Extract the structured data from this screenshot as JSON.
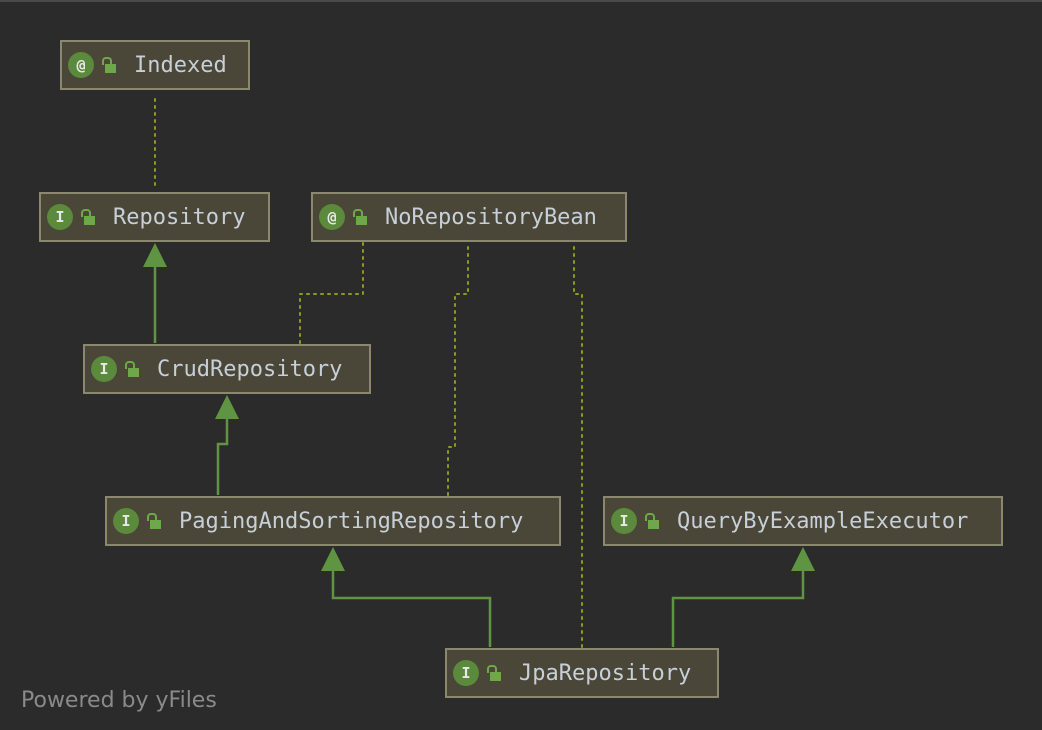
{
  "diagram": {
    "nodes": {
      "indexed": {
        "kind": "@",
        "label": "Indexed"
      },
      "repository": {
        "kind": "I",
        "label": "Repository"
      },
      "no_repository_bean": {
        "kind": "@",
        "label": "NoRepositoryBean"
      },
      "crud_repository": {
        "kind": "I",
        "label": "CrudRepository"
      },
      "paging_and_sorting_repository": {
        "kind": "I",
        "label": "PagingAndSortingRepository"
      },
      "query_by_example_executor": {
        "kind": "I",
        "label": "QueryByExampleExecutor"
      },
      "jpa_repository": {
        "kind": "I",
        "label": "JpaRepository"
      }
    },
    "edges": [
      {
        "from": "repository",
        "to": "indexed",
        "type": "annotation"
      },
      {
        "from": "crud_repository",
        "to": "repository",
        "type": "extends"
      },
      {
        "from": "crud_repository",
        "to": "no_repository_bean",
        "type": "annotation"
      },
      {
        "from": "paging_and_sorting_repository",
        "to": "crud_repository",
        "type": "extends"
      },
      {
        "from": "paging_and_sorting_repository",
        "to": "no_repository_bean",
        "type": "annotation"
      },
      {
        "from": "jpa_repository",
        "to": "paging_and_sorting_repository",
        "type": "extends"
      },
      {
        "from": "jpa_repository",
        "to": "query_by_example_executor",
        "type": "extends"
      },
      {
        "from": "jpa_repository",
        "to": "no_repository_bean",
        "type": "annotation"
      }
    ],
    "icons": {
      "visibility": "lock-open-icon",
      "annotation_kind": "at-sign-icon",
      "interface_kind": "interface-icon"
    },
    "colors": {
      "background": "#2b2b2b",
      "node_fill": "#4a4638",
      "node_border": "#8b8870",
      "node_text": "#c7cfd9",
      "badge": "#5b8a3c",
      "extends_edge": "#5f9443",
      "annotation_edge": "#8c9a22"
    }
  },
  "footer": {
    "text": "Powered by yFiles"
  }
}
